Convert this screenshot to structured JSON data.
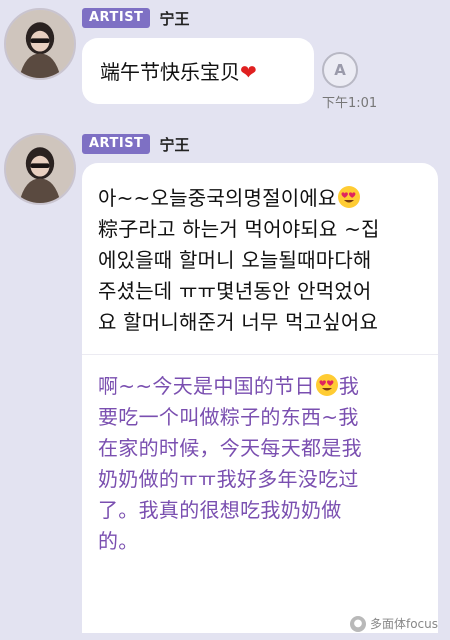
{
  "messages": [
    {
      "badge": "ARTIST",
      "sender": "宁王",
      "text": "端午节快乐宝贝",
      "emoji": "❤",
      "translate_icon": "translate-icon",
      "time": "下午1:01"
    },
    {
      "badge": "ARTIST",
      "sender": "宁王",
      "korean": [
        "아~~오늘중국의명절이에요",
        "粽子라고 하는거 먹어야되요 ~집",
        "에있을때 할머니 오늘될때마다해",
        "주셨는데 ㅠㅠ몇년동안 안먹었어",
        "요 할머니해준거 너무 먹고싶어요"
      ],
      "chinese": [
        "啊~~今天是中国的节日",
        "要吃一个叫做粽子的东西~我",
        "在家的时候，今天每天都是我",
        "奶奶做的ㅠㅠ我好多年没吃过",
        "了。我真的很想吃我奶奶做",
        "的。"
      ],
      "chinese_line1_suffix": "我"
    }
  ],
  "watermark": "多面体focus",
  "icons": [
    "heart-eyes-emoji",
    "red-heart-emoji",
    "translate-icon",
    "avatar"
  ]
}
